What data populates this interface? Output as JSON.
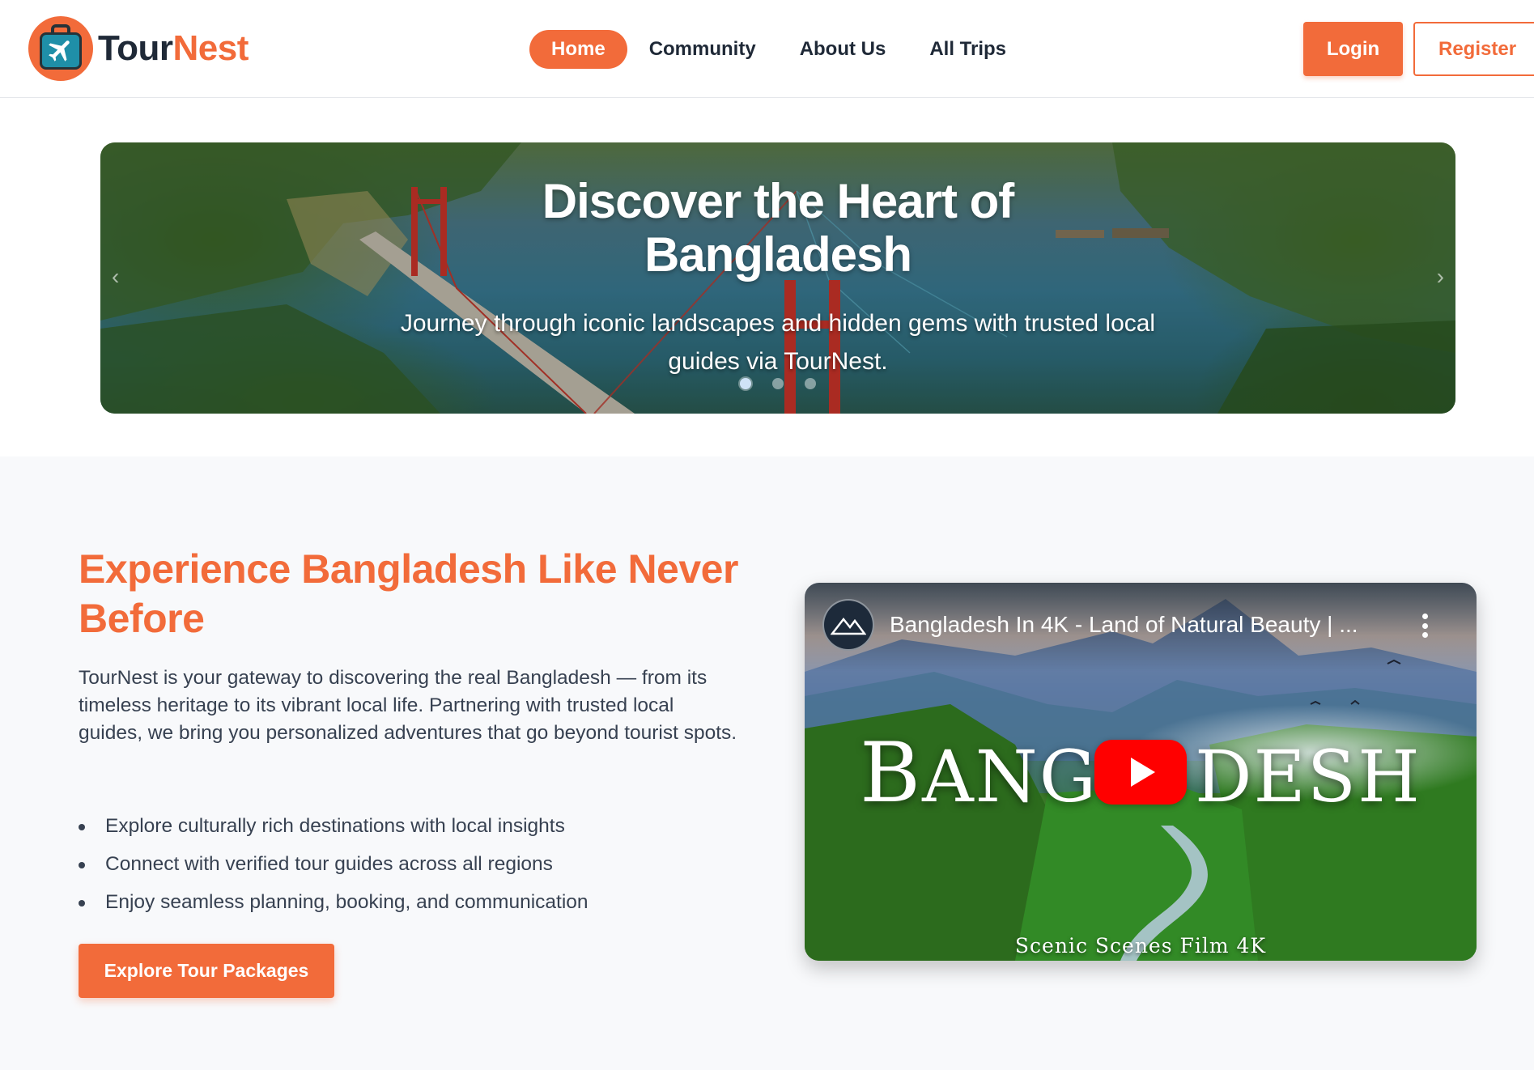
{
  "brand": {
    "name_part1": "Tour",
    "name_part2": "Nest",
    "logo_icon": "suitcase-plane-icon"
  },
  "nav": {
    "items": [
      {
        "label": "Home",
        "active": true
      },
      {
        "label": "Community",
        "active": false
      },
      {
        "label": "About Us",
        "active": false
      },
      {
        "label": "All Trips",
        "active": false
      }
    ]
  },
  "auth": {
    "login_label": "Login",
    "register_label": "Register"
  },
  "hero": {
    "title_line1": "Discover the Heart of",
    "title_line2": "Bangladesh",
    "subtitle": "Journey through iconic landscapes and hidden gems with trusted local guides via TourNest.",
    "slides_count": 3,
    "active_slide": 1
  },
  "experience": {
    "title": "Experience Bangladesh Like Never Before",
    "description": "TourNest is your gateway to discovering the real Bangladesh — from its timeless heritage to its vibrant local life. Partnering with trusted local guides, we bring you personalized adventures that go beyond tourist spots.",
    "features": [
      "Explore culturally rich destinations with local insights",
      "Connect with verified tour guides across all regions",
      "Enjoy seamless planning, booking, and communication"
    ],
    "cta_label": "Explore Tour Packages"
  },
  "video": {
    "title": "Bangladesh In 4K - Land of Natural Beauty | ...",
    "overlay_word_cap1": "B",
    "overlay_word_rest1": "ANG",
    "overlay_word_rest2": "DESH",
    "credit": "Scenic Scenes Film 4K",
    "play_icon": "youtube-play-icon",
    "menu_icon": "kebab-menu-icon"
  },
  "colors": {
    "accent": "#f26b3a",
    "text": "#1f2937",
    "body_text": "#374151",
    "background": "#f8f9fb"
  }
}
